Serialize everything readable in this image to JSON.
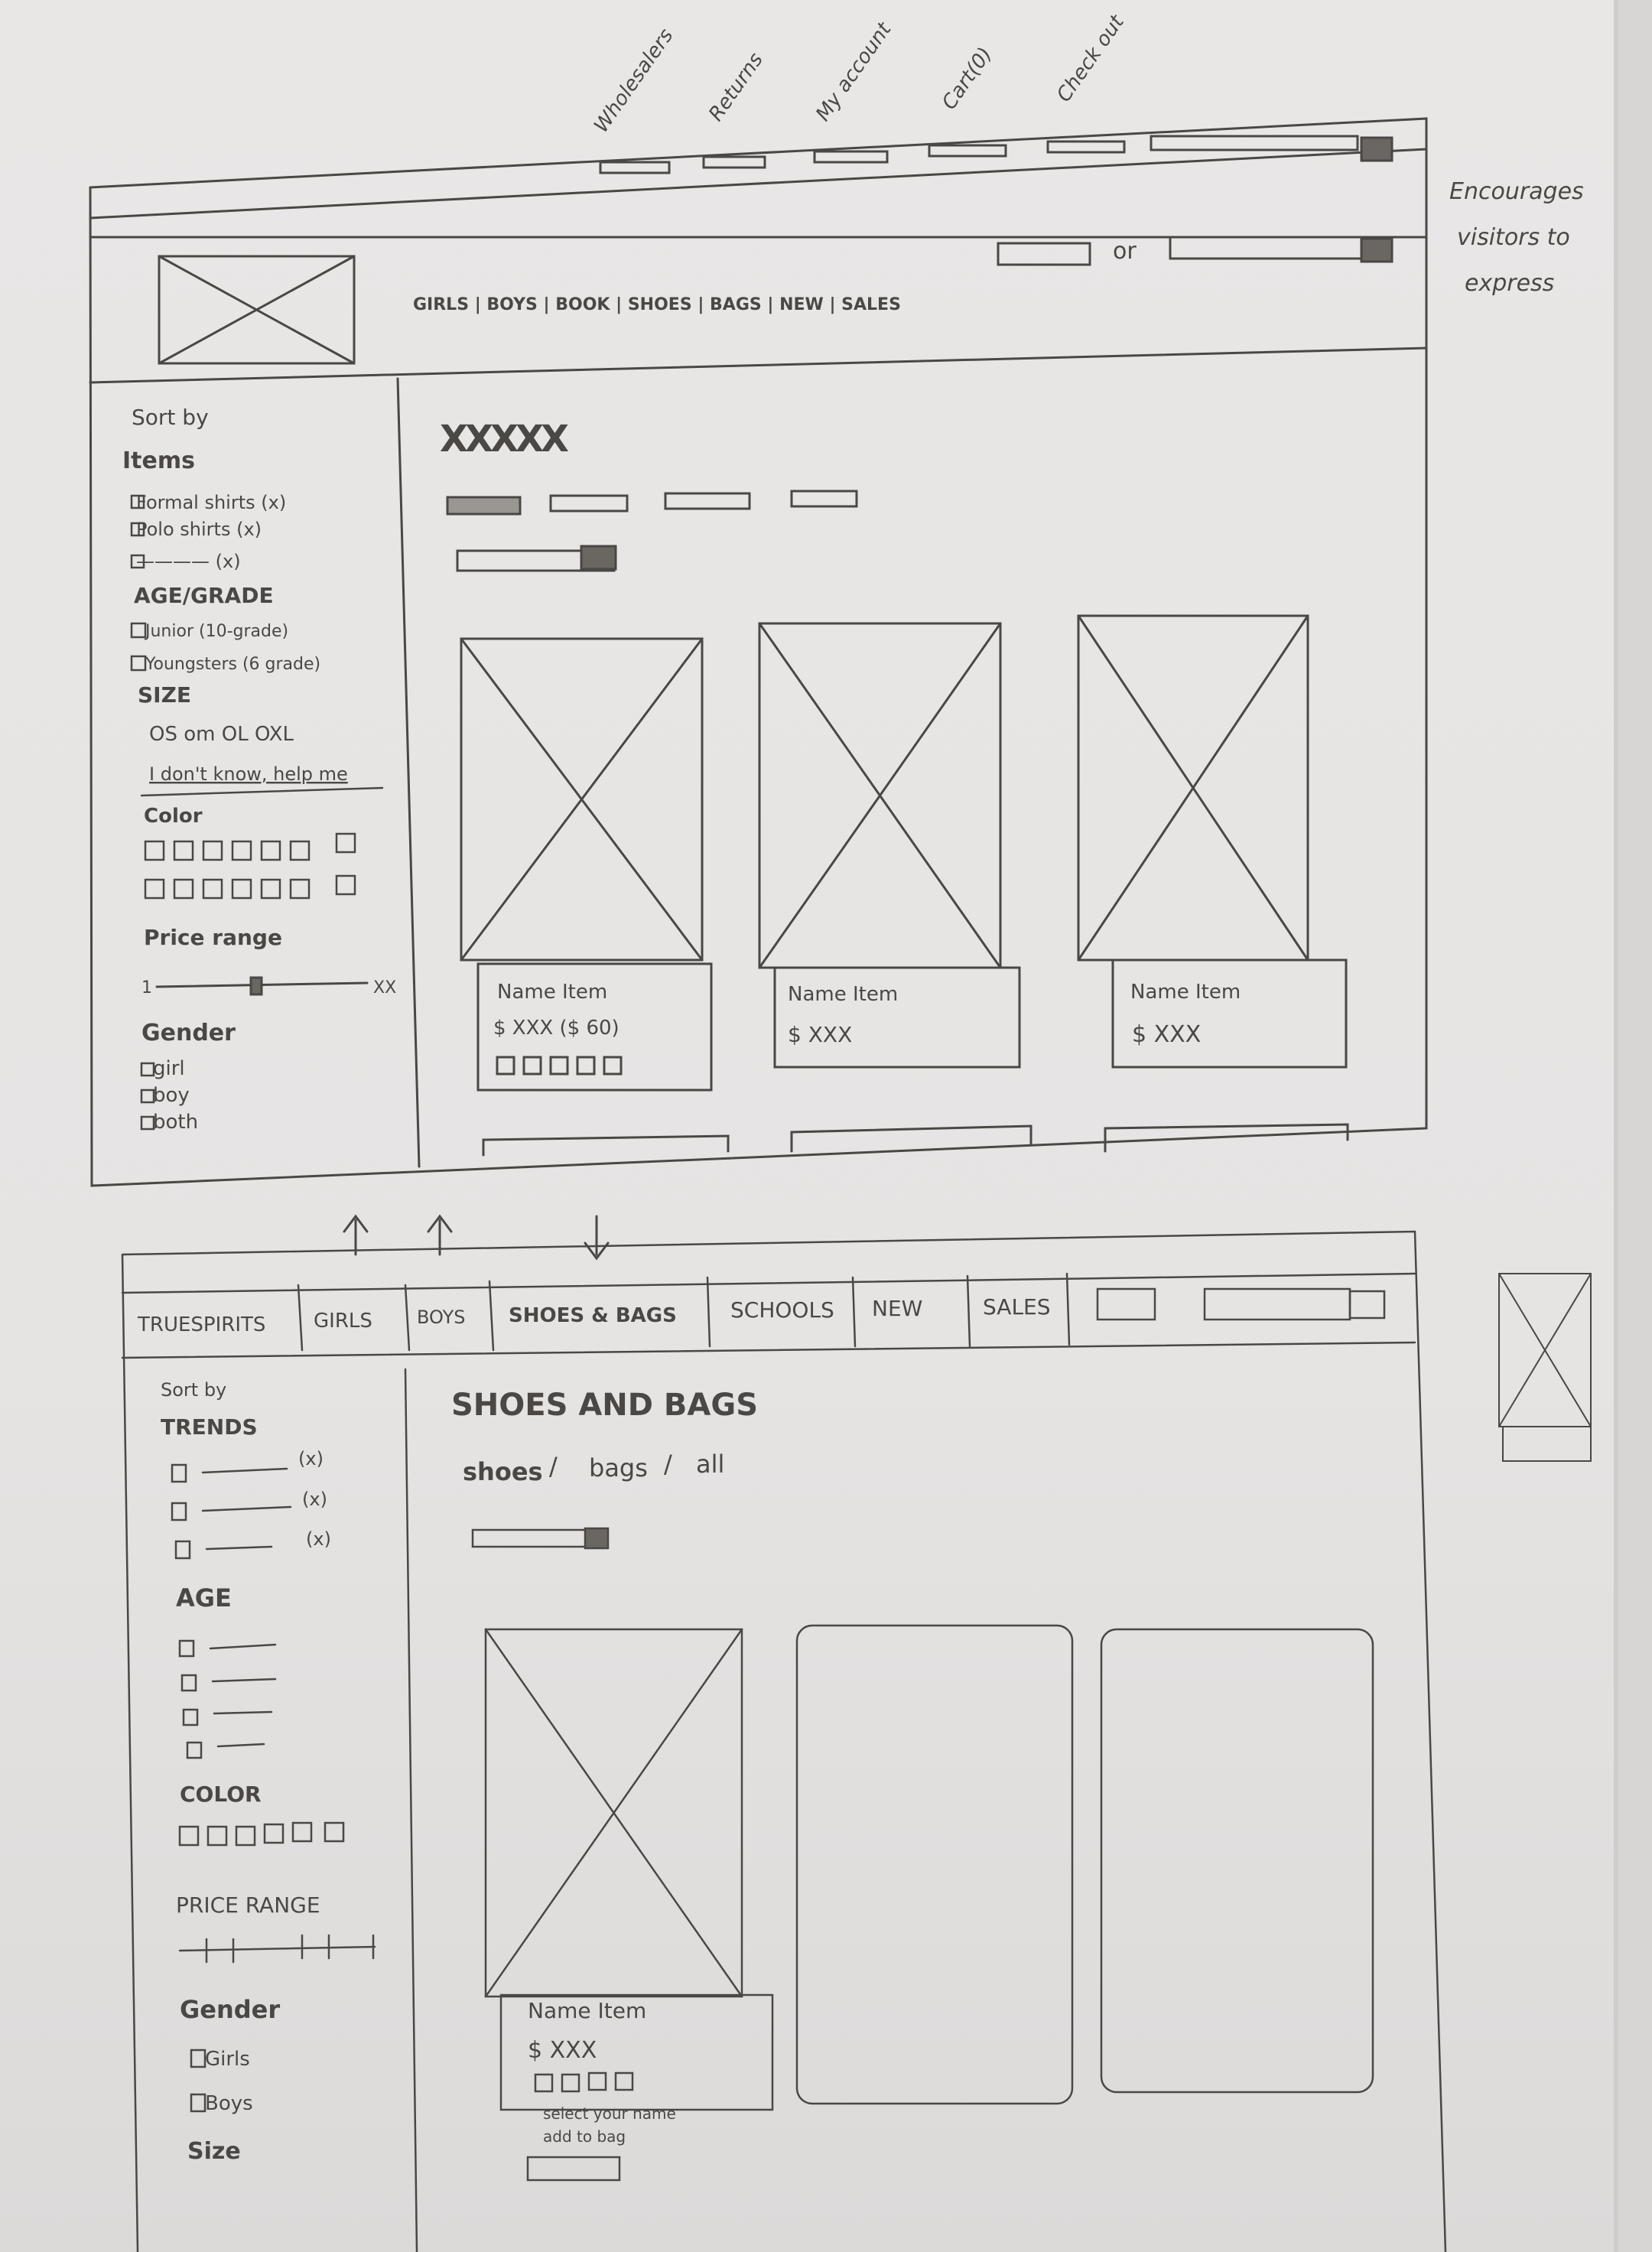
{
  "annotations": {
    "nav_notes": [
      "Wholesalers",
      "Returns",
      "My account",
      "Cart(0)",
      "Check out"
    ],
    "side_note": "Encourages visitors to express"
  },
  "sketch1": {
    "header": {
      "nav_links": [
        "GIRLS",
        "BOYS",
        "BOOK",
        "SHOES",
        "BAGS",
        "NEW",
        "SALES"
      ],
      "search_or": "or"
    },
    "sidebar": {
      "sort_by": "Sort by",
      "items_heading": "Items",
      "items": [
        "Formal shirts (x)",
        "Polo shirts (x)",
        "———— (x)"
      ],
      "age_heading": "AGE/GRADE",
      "age_options": [
        "Junior (10-grade)",
        "Youngsters (6 grade)"
      ],
      "size_heading": "SIZE",
      "size_values": "OS om OL OXL",
      "size_help": "I don't know, help me",
      "color_heading": "Color",
      "price_heading": "Price range",
      "price_min": "1",
      "price_max": "XX",
      "gender_heading": "Gender",
      "gender_options": [
        "girl",
        "boy",
        "both"
      ]
    },
    "main": {
      "title": "XXXXX",
      "products": [
        {
          "name": "Name Item",
          "price": "$ XXX ($ 60)"
        },
        {
          "name": "Name Item",
          "price": "$ XXX"
        },
        {
          "name": "Name Item",
          "price": "$ XXX"
        }
      ]
    }
  },
  "sketch2": {
    "nav_tabs": [
      "TRUESPIRITS",
      "GIRLS",
      "BOYS",
      "SHOES & BAGS",
      "SCHOOLS",
      "NEW",
      "SALES"
    ],
    "sidebar": {
      "sort_by": "Sort by",
      "trends_heading": "TRENDS",
      "trend_counts": [
        "(x)",
        "(x)",
        "(x)"
      ],
      "age_heading": "AGE",
      "color_heading": "COLOR",
      "price_heading": "PRICE RANGE",
      "gender_heading": "Gender",
      "gender_options": [
        "Girls",
        "Boys"
      ],
      "size_heading": "Size"
    },
    "main": {
      "title": "SHOES AND BAGS",
      "subnav": [
        "shoes",
        "bags",
        "all"
      ],
      "product": {
        "name": "Name Item",
        "price": "$ XXX",
        "options": [
          "select your name",
          "add to bag"
        ]
      }
    }
  }
}
